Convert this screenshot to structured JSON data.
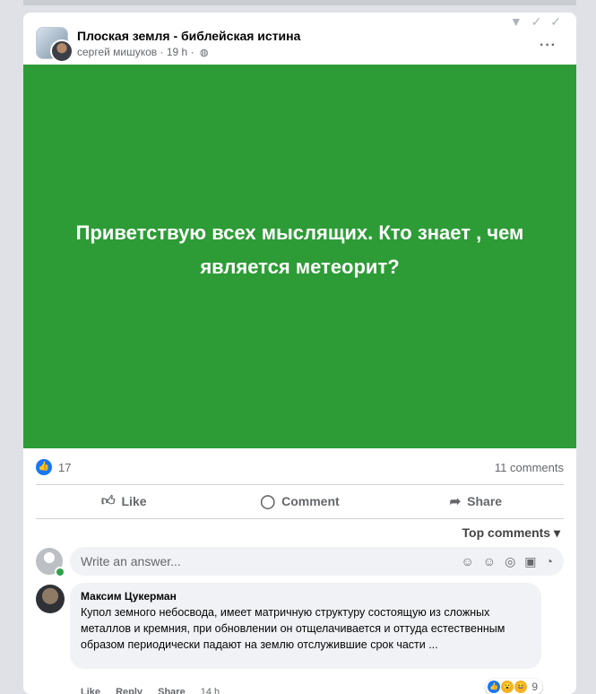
{
  "post": {
    "group_name": "Плоская земля - библейская истина",
    "author": "сергей мишуков",
    "time": "19 h",
    "meta_separator": "·",
    "globe_icon": "◍",
    "more": "···",
    "top_icons": "▼ ✓ ✓",
    "banner_text": "Приветствую всех мыслящих. Кто знает , чем является метеорит?",
    "banner_color": "#2d9c36",
    "like_count": "17",
    "comment_count": "11 comments"
  },
  "actions": {
    "like": "Like",
    "comment": "Comment",
    "share": "Share"
  },
  "sort_label": "Top comments",
  "write_placeholder": "Write an answer...",
  "comment": {
    "author": "Максим Цукерман",
    "text": "Купол земного небосвода, имеет матричную структуру состоящую из сложных металлов и кремния, при обновлении он отщелачивается и оттуда естественным образом периодически падают на землю отслужившие срок части ...",
    "reaction_count": "9",
    "like": "Like",
    "reply": "Reply",
    "share": "Share",
    "time": "14 h"
  },
  "colors": {
    "accent": "#1877f2",
    "online": "#31a24c"
  }
}
